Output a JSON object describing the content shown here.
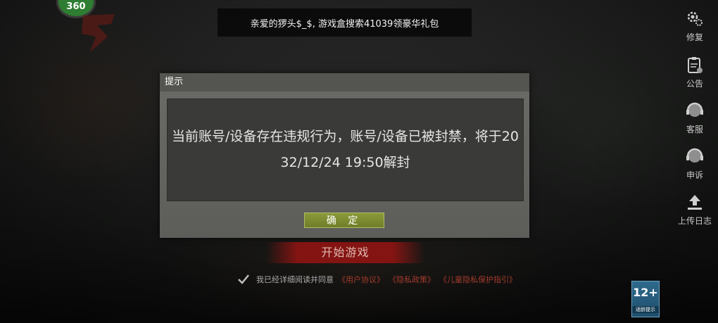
{
  "logo": {
    "badge_text": "360",
    "title_glyph": ""
  },
  "banner": {
    "text": "亲爱的猡头$_$, 游戏盒搜索41039领豪华礼包"
  },
  "sidebar": {
    "items": [
      {
        "label": "修复",
        "icon": "gear-icon"
      },
      {
        "label": "公告",
        "icon": "notice-icon"
      },
      {
        "label": "客服",
        "icon": "headset-icon"
      },
      {
        "label": "申诉",
        "icon": "appeal-headset-icon"
      },
      {
        "label": "上传日志",
        "icon": "upload-icon"
      }
    ]
  },
  "dialog": {
    "title": "提示",
    "message": "当前账号/设备存在违规行为，账号/设备已被封禁，将于2032/12/24 19:50解封",
    "confirm_label": "确 定"
  },
  "start_button": {
    "label": "开始游戏"
  },
  "agreement": {
    "prefix": "我已经详细阅读并同意",
    "links": [
      "《用户协议》",
      "《隐私政策》",
      "《儿童隐私保护指引》"
    ]
  },
  "age_badge": {
    "rating": "12+",
    "caption": "适龄提示"
  },
  "colors": {
    "accent_red": "#a33a2c",
    "confirm_green": "#7a8a30",
    "age_blue": "#2f6a8c"
  }
}
